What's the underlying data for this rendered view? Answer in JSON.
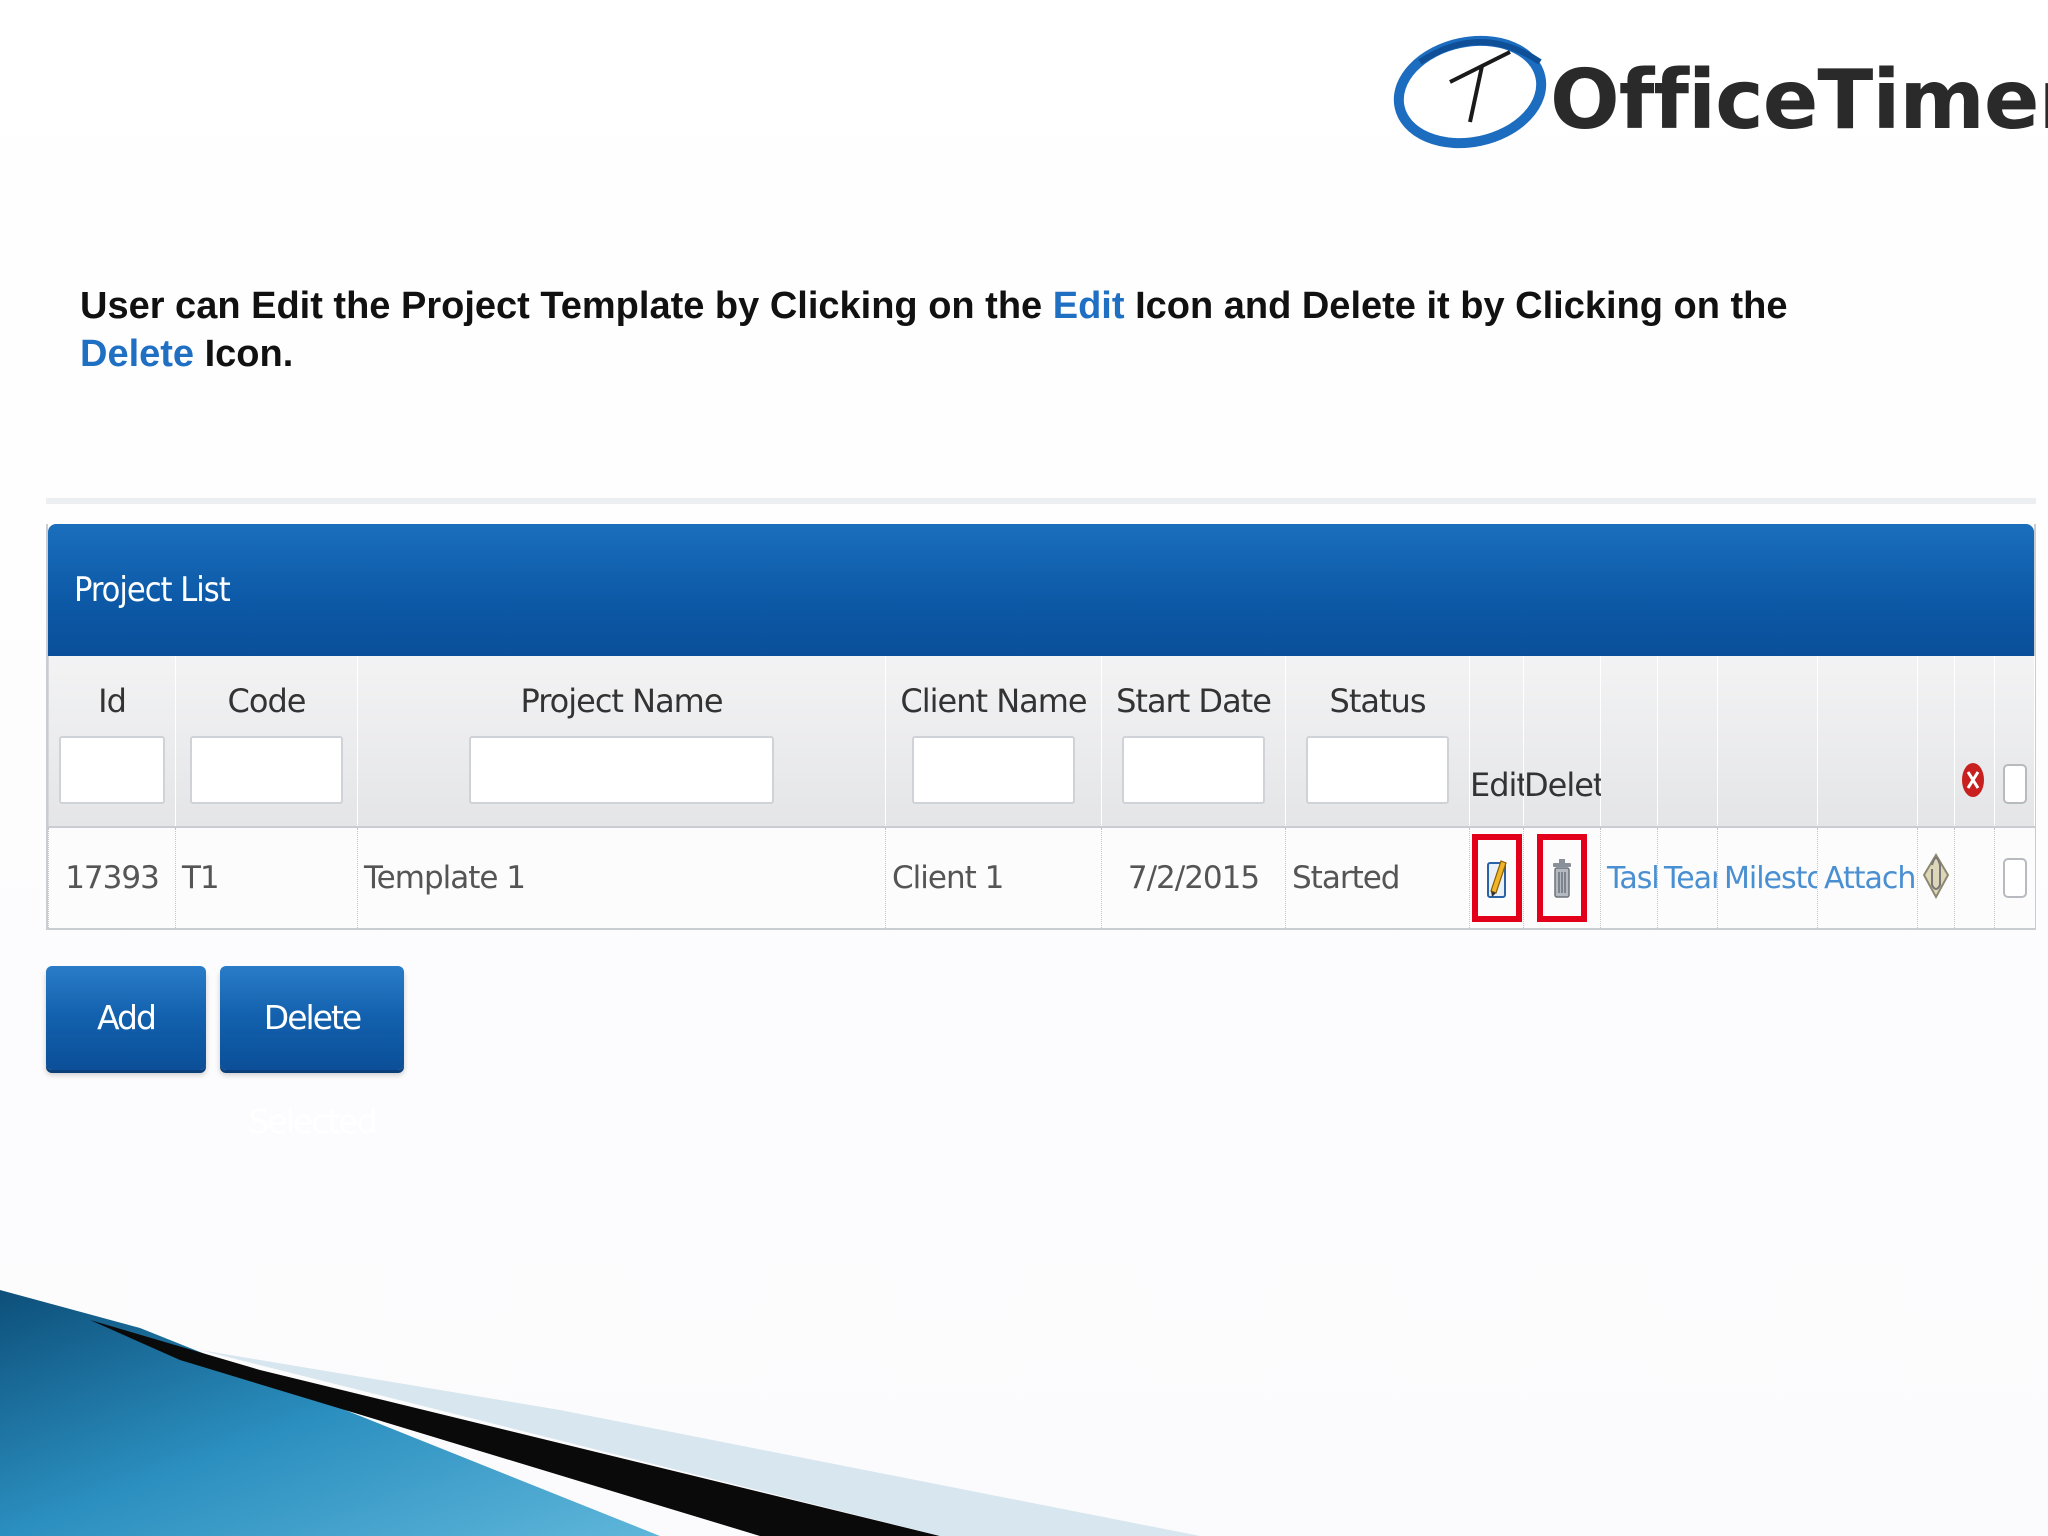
{
  "logo": {
    "text": "OfficeTimer"
  },
  "heading": {
    "part1": "User  can Edit the Project Template by Clicking on the ",
    "edit_word": "Edit",
    "part2": " Icon and  Delete it by Clicking on the ",
    "delete_word": "Delete",
    "part3": " Icon.",
    "highlight_color": "#1f6fc3"
  },
  "grid": {
    "title": "Project List",
    "columns": {
      "id": "Id",
      "code": "Code",
      "project_name": "Project Name",
      "client_name": "Client Name",
      "start_date": "Start Date",
      "status": "Status",
      "edit": "Edit",
      "delete": "Delete"
    },
    "filters": {
      "id": "",
      "code": "",
      "project_name": "",
      "client_name": "",
      "start_date": "",
      "status": ""
    },
    "rows": [
      {
        "id": "17393",
        "code": "T1",
        "project_name": "Template 1",
        "client_name": "Client 1",
        "start_date": "7/2/2015",
        "status": "Started",
        "links": {
          "tasks": "Tasks",
          "team": "Team",
          "milestones": "Milestones",
          "attachment": "Attachment"
        }
      }
    ],
    "highlight_color": "#e3001b"
  },
  "buttons": {
    "add": "Add",
    "delete_selected": "Delete Selected"
  },
  "icons": {
    "logo": "officetimer-clock-icon",
    "delete_selected_header": "red-x-circle-icon",
    "edit": "pencil-edit-icon",
    "delete": "trash-can-icon",
    "attachment": "paperclip-envelope-icon"
  }
}
